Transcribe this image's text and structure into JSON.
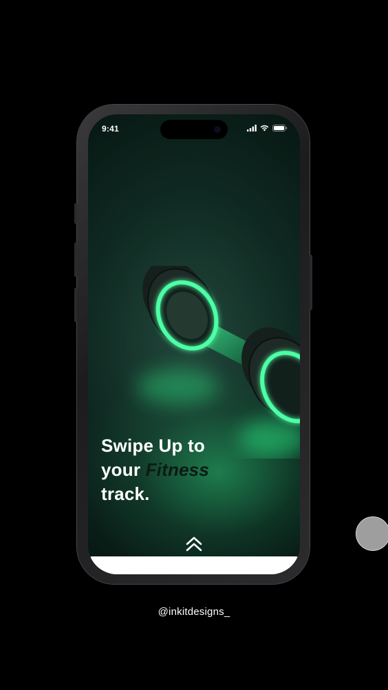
{
  "status_bar": {
    "time": "9:41",
    "icons": [
      "signal-icon",
      "wifi-icon",
      "battery-icon"
    ]
  },
  "hero": {
    "image": "glowing-dumbbell",
    "headline_line1": "Swipe Up to",
    "headline_line2_prefix": "your ",
    "headline_line2_accent": "Fitness",
    "headline_line3": "track."
  },
  "swipe_hint_icon": "double-chevron-up-icon",
  "watermark": "@inkitdesigns_",
  "colors": {
    "background": "#000000",
    "glow_green": "#3dff9a",
    "screen_dark_green": "#0f2a22",
    "accent_text": "#0d1a15"
  }
}
